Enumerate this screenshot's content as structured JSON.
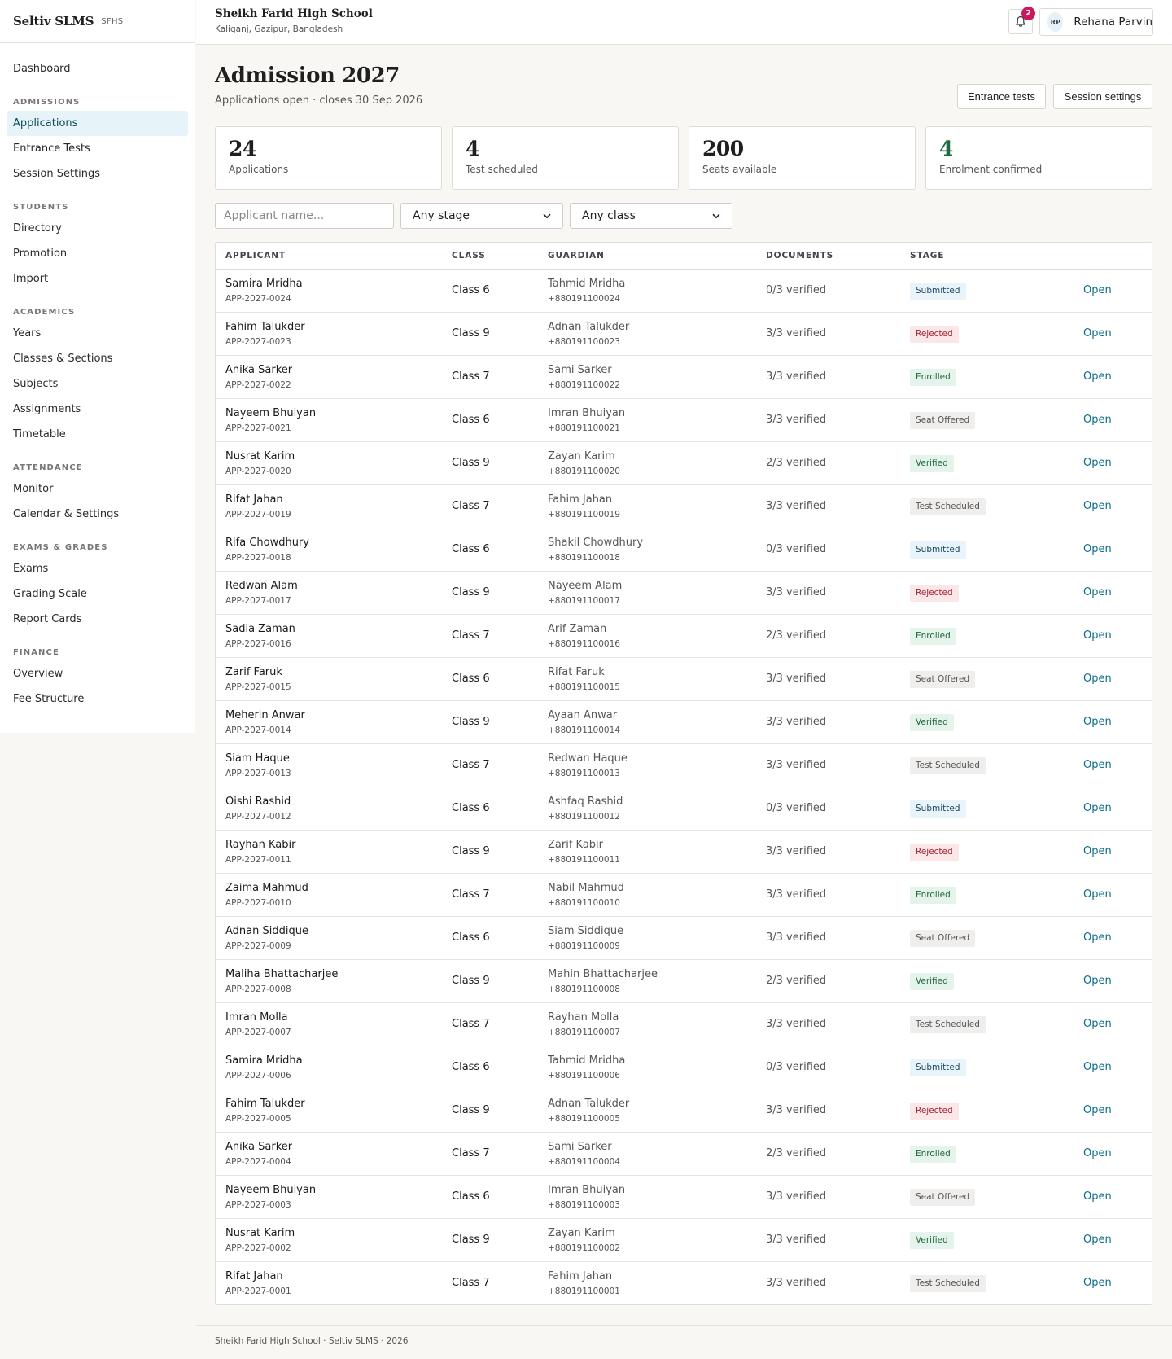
{
  "brand": {
    "name": "Seltiv SLMS",
    "tag": "SFHS"
  },
  "sidebar": {
    "top": [
      {
        "label": "Dashboard"
      }
    ],
    "sections": [
      {
        "title": "ADMISSIONS",
        "items": [
          {
            "label": "Applications",
            "active": true
          },
          {
            "label": "Entrance Tests"
          },
          {
            "label": "Session Settings"
          }
        ]
      },
      {
        "title": "STUDENTS",
        "items": [
          {
            "label": "Directory"
          },
          {
            "label": "Promotion"
          },
          {
            "label": "Import"
          }
        ]
      },
      {
        "title": "ACADEMICS",
        "items": [
          {
            "label": "Years"
          },
          {
            "label": "Classes & Sections"
          },
          {
            "label": "Subjects"
          },
          {
            "label": "Assignments"
          },
          {
            "label": "Timetable"
          }
        ]
      },
      {
        "title": "ATTENDANCE",
        "items": [
          {
            "label": "Monitor"
          },
          {
            "label": "Calendar & Settings"
          }
        ]
      },
      {
        "title": "EXAMS & GRADES",
        "items": [
          {
            "label": "Exams"
          },
          {
            "label": "Grading Scale"
          },
          {
            "label": "Report Cards"
          }
        ]
      },
      {
        "title": "FINANCE",
        "items": [
          {
            "label": "Overview"
          },
          {
            "label": "Fee Structure"
          }
        ]
      }
    ]
  },
  "topbar": {
    "school_name": "Sheikh Farid High School",
    "school_location": "Kaliganj, Gazipur, Bangladesh",
    "notification_count": "2",
    "user_initials": "RP",
    "user_name": "Rehana Parvin"
  },
  "page": {
    "title": "Admission 2027",
    "subtitle": "Applications open · closes 30 Sep 2026",
    "buttons": {
      "entrance_tests": "Entrance tests",
      "session_settings": "Session settings"
    }
  },
  "stats": [
    {
      "value": "24",
      "label": "Applications"
    },
    {
      "value": "4",
      "label": "Test scheduled"
    },
    {
      "value": "200",
      "label": "Seats available"
    },
    {
      "value": "4",
      "label": "Enrolment confirmed",
      "accent": "#1e6b42"
    }
  ],
  "filters": {
    "search_placeholder": "Applicant name...",
    "stage_value": "Any stage",
    "class_value": "Any class"
  },
  "table": {
    "headers": {
      "applicant": "APPLICANT",
      "class": "CLASS",
      "guardian": "GUARDIAN",
      "documents": "DOCUMENTS",
      "stage": "STAGE"
    },
    "open_label": "Open",
    "rows": [
      {
        "name": "Samira Mridha",
        "id": "APP-2027-0024",
        "class": "Class 6",
        "guardian": "Tahmid Mridha",
        "phone": "+880191100024",
        "docs": "0/3 verified",
        "stage": "Submitted",
        "stage_key": "submitted"
      },
      {
        "name": "Fahim Talukder",
        "id": "APP-2027-0023",
        "class": "Class 9",
        "guardian": "Adnan Talukder",
        "phone": "+880191100023",
        "docs": "3/3 verified",
        "stage": "Rejected",
        "stage_key": "rejected"
      },
      {
        "name": "Anika Sarker",
        "id": "APP-2027-0022",
        "class": "Class 7",
        "guardian": "Sami Sarker",
        "phone": "+880191100022",
        "docs": "3/3 verified",
        "stage": "Enrolled",
        "stage_key": "enrolled"
      },
      {
        "name": "Nayeem Bhuiyan",
        "id": "APP-2027-0021",
        "class": "Class 6",
        "guardian": "Imran Bhuiyan",
        "phone": "+880191100021",
        "docs": "3/3 verified",
        "stage": "Seat Offered",
        "stage_key": "seat"
      },
      {
        "name": "Nusrat Karim",
        "id": "APP-2027-0020",
        "class": "Class 9",
        "guardian": "Zayan Karim",
        "phone": "+880191100020",
        "docs": "2/3 verified",
        "stage": "Verified",
        "stage_key": "verified"
      },
      {
        "name": "Rifat Jahan",
        "id": "APP-2027-0019",
        "class": "Class 7",
        "guardian": "Fahim Jahan",
        "phone": "+880191100019",
        "docs": "3/3 verified",
        "stage": "Test Scheduled",
        "stage_key": "test"
      },
      {
        "name": "Rifa Chowdhury",
        "id": "APP-2027-0018",
        "class": "Class 6",
        "guardian": "Shakil Chowdhury",
        "phone": "+880191100018",
        "docs": "0/3 verified",
        "stage": "Submitted",
        "stage_key": "submitted"
      },
      {
        "name": "Redwan Alam",
        "id": "APP-2027-0017",
        "class": "Class 9",
        "guardian": "Nayeem Alam",
        "phone": "+880191100017",
        "docs": "3/3 verified",
        "stage": "Rejected",
        "stage_key": "rejected"
      },
      {
        "name": "Sadia Zaman",
        "id": "APP-2027-0016",
        "class": "Class 7",
        "guardian": "Arif Zaman",
        "phone": "+880191100016",
        "docs": "2/3 verified",
        "stage": "Enrolled",
        "stage_key": "enrolled"
      },
      {
        "name": "Zarif Faruk",
        "id": "APP-2027-0015",
        "class": "Class 6",
        "guardian": "Rifat Faruk",
        "phone": "+880191100015",
        "docs": "3/3 verified",
        "stage": "Seat Offered",
        "stage_key": "seat"
      },
      {
        "name": "Meherin Anwar",
        "id": "APP-2027-0014",
        "class": "Class 9",
        "guardian": "Ayaan Anwar",
        "phone": "+880191100014",
        "docs": "3/3 verified",
        "stage": "Verified",
        "stage_key": "verified"
      },
      {
        "name": "Siam Haque",
        "id": "APP-2027-0013",
        "class": "Class 7",
        "guardian": "Redwan Haque",
        "phone": "+880191100013",
        "docs": "3/3 verified",
        "stage": "Test Scheduled",
        "stage_key": "test"
      },
      {
        "name": "Oishi Rashid",
        "id": "APP-2027-0012",
        "class": "Class 6",
        "guardian": "Ashfaq Rashid",
        "phone": "+880191100012",
        "docs": "0/3 verified",
        "stage": "Submitted",
        "stage_key": "submitted"
      },
      {
        "name": "Rayhan Kabir",
        "id": "APP-2027-0011",
        "class": "Class 9",
        "guardian": "Zarif Kabir",
        "phone": "+880191100011",
        "docs": "3/3 verified",
        "stage": "Rejected",
        "stage_key": "rejected"
      },
      {
        "name": "Zaima Mahmud",
        "id": "APP-2027-0010",
        "class": "Class 7",
        "guardian": "Nabil Mahmud",
        "phone": "+880191100010",
        "docs": "3/3 verified",
        "stage": "Enrolled",
        "stage_key": "enrolled"
      },
      {
        "name": "Adnan Siddique",
        "id": "APP-2027-0009",
        "class": "Class 6",
        "guardian": "Siam Siddique",
        "phone": "+880191100009",
        "docs": "3/3 verified",
        "stage": "Seat Offered",
        "stage_key": "seat"
      },
      {
        "name": "Maliha Bhattacharjee",
        "id": "APP-2027-0008",
        "class": "Class 9",
        "guardian": "Mahin Bhattacharjee",
        "phone": "+880191100008",
        "docs": "2/3 verified",
        "stage": "Verified",
        "stage_key": "verified"
      },
      {
        "name": "Imran Molla",
        "id": "APP-2027-0007",
        "class": "Class 7",
        "guardian": "Rayhan Molla",
        "phone": "+880191100007",
        "docs": "3/3 verified",
        "stage": "Test Scheduled",
        "stage_key": "test"
      },
      {
        "name": "Samira Mridha",
        "id": "APP-2027-0006",
        "class": "Class 6",
        "guardian": "Tahmid Mridha",
        "phone": "+880191100006",
        "docs": "0/3 verified",
        "stage": "Submitted",
        "stage_key": "submitted"
      },
      {
        "name": "Fahim Talukder",
        "id": "APP-2027-0005",
        "class": "Class 9",
        "guardian": "Adnan Talukder",
        "phone": "+880191100005",
        "docs": "3/3 verified",
        "stage": "Rejected",
        "stage_key": "rejected"
      },
      {
        "name": "Anika Sarker",
        "id": "APP-2027-0004",
        "class": "Class 7",
        "guardian": "Sami Sarker",
        "phone": "+880191100004",
        "docs": "2/3 verified",
        "stage": "Enrolled",
        "stage_key": "enrolled"
      },
      {
        "name": "Nayeem Bhuiyan",
        "id": "APP-2027-0003",
        "class": "Class 6",
        "guardian": "Imran Bhuiyan",
        "phone": "+880191100003",
        "docs": "3/3 verified",
        "stage": "Seat Offered",
        "stage_key": "seat"
      },
      {
        "name": "Nusrat Karim",
        "id": "APP-2027-0002",
        "class": "Class 9",
        "guardian": "Zayan Karim",
        "phone": "+880191100002",
        "docs": "3/3 verified",
        "stage": "Verified",
        "stage_key": "verified"
      },
      {
        "name": "Rifat Jahan",
        "id": "APP-2027-0001",
        "class": "Class 7",
        "guardian": "Fahim Jahan",
        "phone": "+880191100001",
        "docs": "3/3 verified",
        "stage": "Test Scheduled",
        "stage_key": "test"
      }
    ]
  },
  "footer": {
    "text": "Sheikh Farid High School · Seltiv SLMS · 2026"
  },
  "icons": {
    "notification": "bell-icon",
    "select": "chevron-down-icon"
  }
}
